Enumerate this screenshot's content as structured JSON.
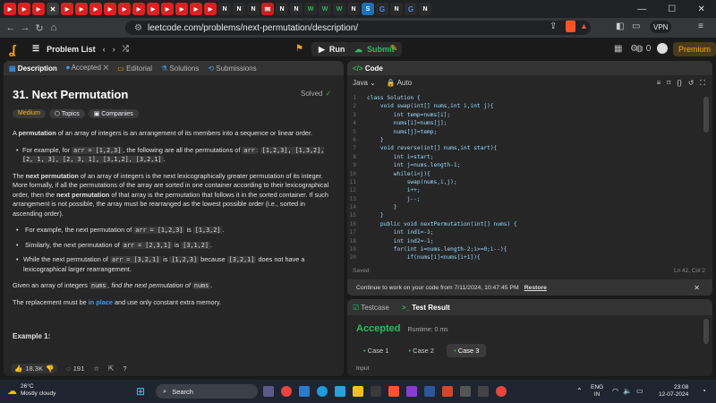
{
  "browser": {
    "tabs": [
      "YouTube",
      "YouTube",
      "YouTube",
      "Close",
      "YouTube",
      "YouTube",
      "YouTube",
      "YouTube",
      "YouTube",
      "YouTube",
      "YouTube",
      "YouTube",
      "YouTube",
      "YouTube",
      "YouTube",
      "N",
      "N",
      "N",
      "Mail",
      "N",
      "N",
      "W",
      "W",
      "W",
      "N",
      "S",
      "Google",
      "N",
      "Google",
      "N"
    ],
    "url": "leetcode.com/problems/next-permutation/description/",
    "vpn_label": "VPN"
  },
  "colors": {
    "accent": "#ffa116",
    "green": "#2cbb5d",
    "blue": "#3e9cf1"
  },
  "toolbar": {
    "problem_list": "Problem List",
    "run": "Run",
    "submit": "Submit",
    "streak": "0",
    "premium": "Premium"
  },
  "desc_tabs": [
    "Description",
    "Accepted",
    "Editorial",
    "Solutions",
    "Submissions"
  ],
  "problem": {
    "title": "31. Next Permutation",
    "status": "Solved",
    "difficulty": "Medium",
    "topics": "Topics",
    "companies": "Companies",
    "p1_bold": "permutation",
    "p1_rest": " of an array of integers is an arrangement of its members into a sequence or linear order.",
    "b1_text": "For example, for ",
    "b1_code": "arr = [1,2,3]",
    "b1_text2": ", the following are all the permutations of ",
    "b1_code2": "arr",
    "b1_code3": "[1,2,3], [1,3,2], [2, 1, 3], [2, 3, 1], [3,1,2], [3,2,1]",
    "p2_a": "The ",
    "p2_bold1": "next permutation",
    "p2_b": " of an array of integers is the next lexicographically greater permutation of its integer. More formally, if all the permutations of the array are sorted in one container according to their lexicographical order, then the ",
    "p2_bold2": "next permutation",
    "p2_c": " of that array is the permutation that follows it in the sorted container. If such arrangement is not possible, the array must be rearranged as the lowest possible order (i.e., sorted in ascending order).",
    "b2_text": "For example, the next permutation of ",
    "b2_code": "arr = [1,2,3]",
    "b2_code2": "[1,3,2]",
    "b3_text": "Similarly, the next permutation of ",
    "b3_code": "arr = [2,3,1]",
    "b3_code2": "[3,1,2]",
    "b4_text": "While the next permutation of ",
    "b4_code": "arr = [3,2,1]",
    "b4_code2": "[1,2,3]",
    "b4_text2": " because ",
    "b4_code3": "[3,2,1]",
    "b4_text3": " does not have a lexicographical larger rearrangement.",
    "p3_a": "Given an array of integers ",
    "p3_code": "nums",
    "p3_italic": ", find the next permutation of ",
    "p4_a": "The replacement must be ",
    "p4_link": "in place",
    "p4_b": " and use only constant extra memory.",
    "example": "Example 1:",
    "likes": "18.3K",
    "comments": "191"
  },
  "code": {
    "header": "Code",
    "language": "Java",
    "mode": "Auto",
    "lines": [
      "class Solution {",
      "    void swap(int[] nums,int i,int j){",
      "        int temp=nums[i];",
      "        nums[i]=nums[j];",
      "        nums[j]=temp;",
      "    }",
      "    void reverse(int[] nums,int start){",
      "        int i=start;",
      "        int j=nums.length-1;",
      "        while(i<j){",
      "            swap(nums,i,j);",
      "            i++;",
      "            j--;",
      "        }",
      "    }",
      "    public void nextPermutation(int[] nums) {",
      "        int ind1=-1;",
      "        int ind2=-1;",
      "        for(int i=nums.length-2;i>=0;i--){",
      "            if(nums[i]<nums[i+1]){"
    ],
    "saved": "Saved",
    "position": "Ln 42, Col 2",
    "restore_msg": "Continue to work on your code from 7/11/2024, 10:47:45 PM",
    "restore": "Restore"
  },
  "testcase": {
    "tab1": "Testcase",
    "tab2": "Test Result",
    "result": "Accepted",
    "runtime": "Runtime: 0 ms",
    "cases": [
      "Case 1",
      "Case 2",
      "Case 3"
    ],
    "input_label": "Input"
  },
  "taskbar": {
    "temp": "26°C",
    "weather": "Mostly cloudy",
    "search": "Search",
    "lang": "ENG",
    "region": "IN",
    "time": "23:08",
    "date": "12-07-2024"
  }
}
